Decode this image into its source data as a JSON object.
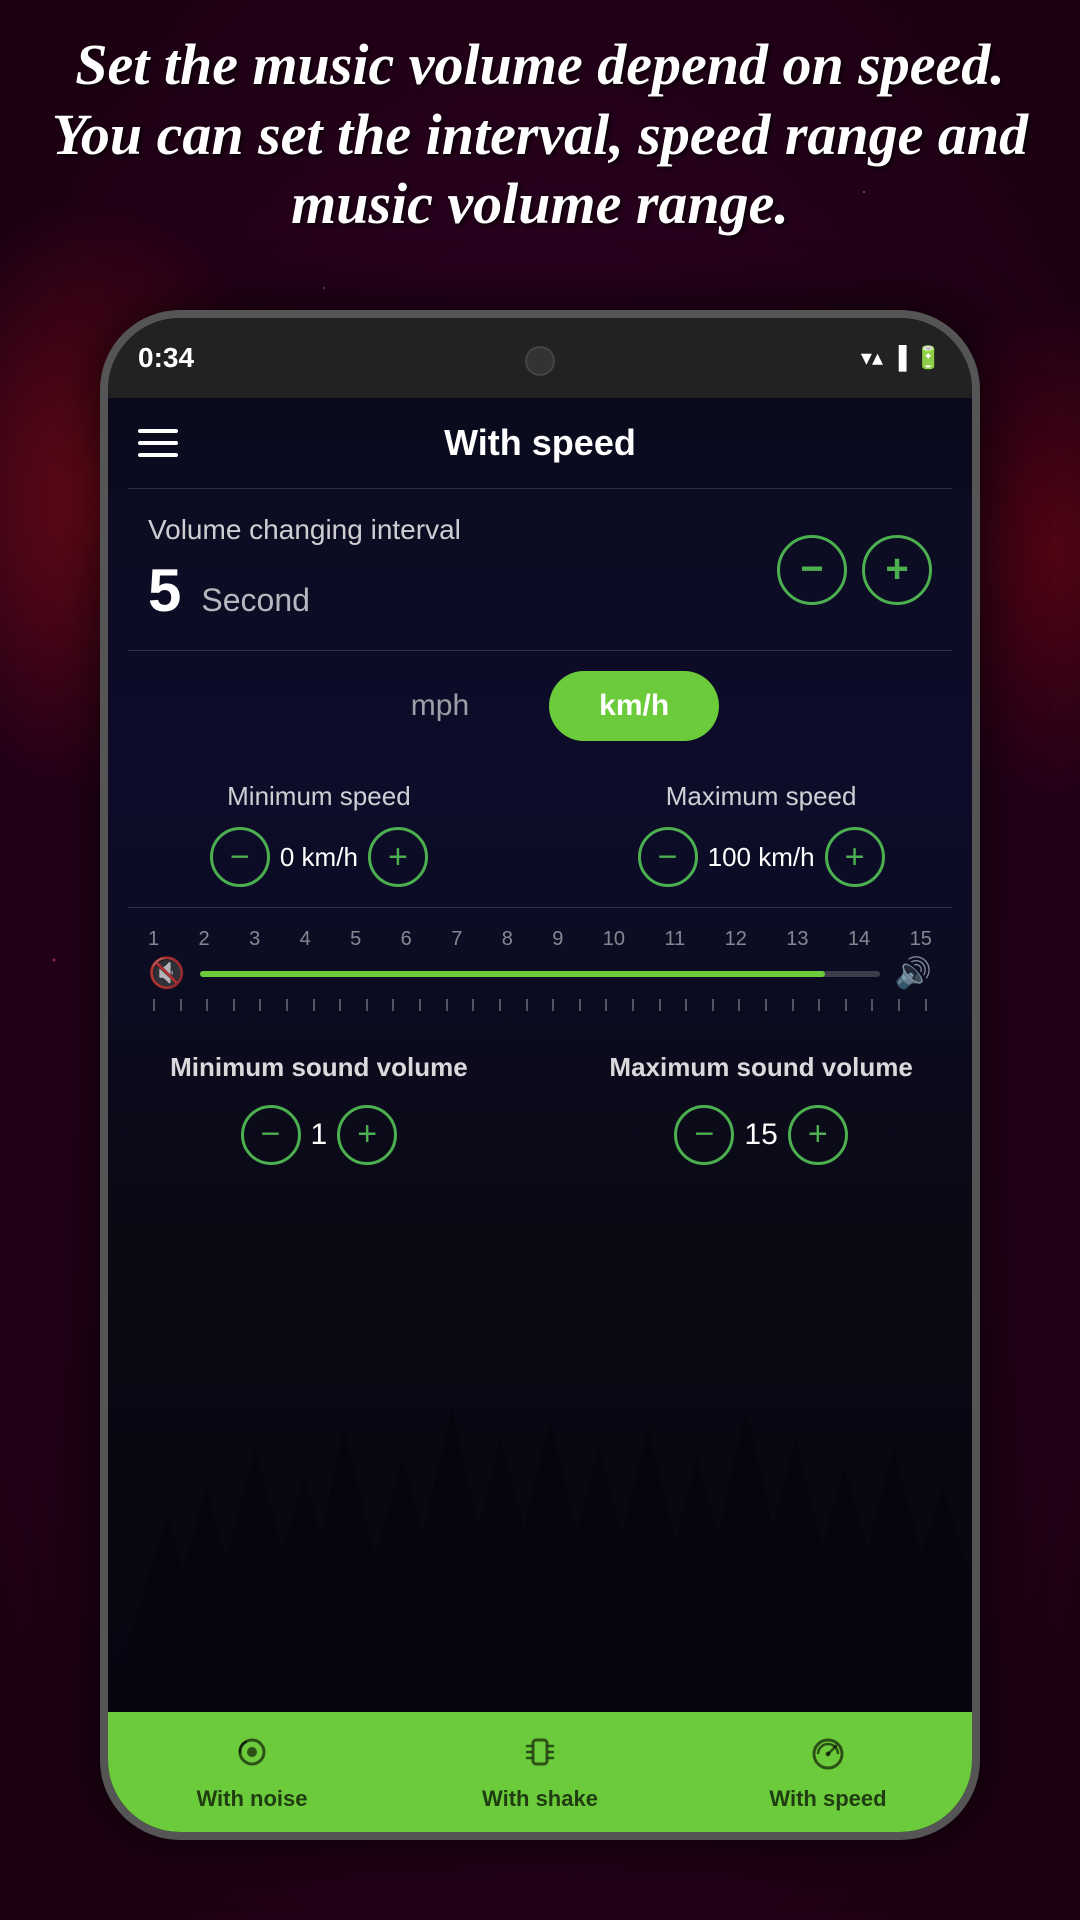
{
  "headline": {
    "text": "Set the music volume depend on speed. You can set the interval, speed range and music volume range."
  },
  "status_bar": {
    "time": "0:34",
    "icons": [
      "wifi",
      "signal",
      "battery"
    ]
  },
  "app_header": {
    "title": "With speed",
    "menu_icon": "hamburger"
  },
  "volume_interval": {
    "label": "Volume changing interval",
    "value": "5",
    "unit": "Second",
    "minus_label": "−",
    "plus_label": "+"
  },
  "speed_unit": {
    "options": [
      "mph",
      "km/h"
    ],
    "active": "km/h"
  },
  "min_speed": {
    "label": "Minimum speed",
    "value": "0 km/h",
    "minus_label": "−",
    "plus_label": "+"
  },
  "max_speed": {
    "label": "Maximum speed",
    "value": "100 km/h",
    "minus_label": "−",
    "plus_label": "+"
  },
  "volume_slider": {
    "numbers": [
      "1",
      "2",
      "3",
      "4",
      "5",
      "6",
      "7",
      "8",
      "9",
      "10",
      "11",
      "12",
      "13",
      "14",
      "15"
    ],
    "fill_percent": 92,
    "low_icon": "🔇",
    "high_icon": "🔊"
  },
  "min_sound": {
    "label": "Minimum sound volume",
    "value": "1",
    "minus_label": "−",
    "plus_label": "+"
  },
  "max_sound": {
    "label": "Maximum sound volume",
    "value": "15",
    "minus_label": "−",
    "plus_label": "+"
  },
  "bottom_nav": {
    "items": [
      {
        "id": "with-noise",
        "label": "With noise",
        "icon": "🎵"
      },
      {
        "id": "with-shake",
        "label": "With shake",
        "icon": "📳"
      },
      {
        "id": "with-speed",
        "label": "With speed",
        "icon": "🏎"
      }
    ]
  }
}
